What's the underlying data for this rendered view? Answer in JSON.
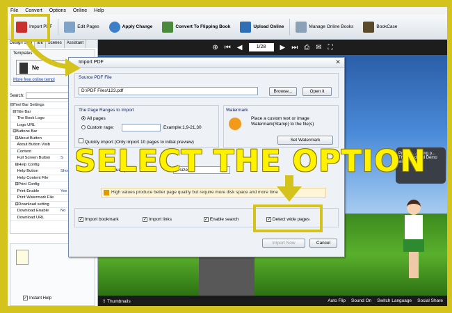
{
  "menubar": {
    "items": [
      "File",
      "Convert",
      "Options",
      "Online",
      "Help"
    ]
  },
  "toolbar": {
    "buttons": [
      {
        "label": "Import PDF",
        "icon": "pdf-icon"
      },
      {
        "label": "Edit Pages",
        "icon": "edit-pages-icon"
      },
      {
        "label": "Apply Change",
        "icon": "apply-change-icon"
      },
      {
        "label": "Convert To Flipping Book",
        "icon": "convert-icon"
      },
      {
        "label": "Upload Online",
        "icon": "upload-icon"
      },
      {
        "label": "Manage Online Books",
        "icon": "manage-books-icon"
      },
      {
        "label": "BookCase",
        "icon": "bookcase-icon"
      }
    ]
  },
  "left": {
    "tabs": [
      "Design Setti",
      "ark",
      "Scenes",
      "Assistant"
    ],
    "templates_title": "Templates",
    "new_label": "Ne",
    "more_templates_link": "More free online templ",
    "search_label": "Search:",
    "tree": [
      {
        "label": "⊟Tool Bar Settings",
        "value": ""
      },
      {
        "label": "  ⊟Title Bar",
        "value": ""
      },
      {
        "label": "      The Book Logo",
        "value": ""
      },
      {
        "label": "      Logo URL",
        "value": ""
      },
      {
        "label": "  ⊟Buttons Bar",
        "value": ""
      },
      {
        "label": "    ⊟About Button",
        "value": ""
      },
      {
        "label": "      About Button Visib",
        "value": ""
      },
      {
        "label": "      Content",
        "value": ""
      },
      {
        "label": "      Full Screen Button",
        "value": "S"
      },
      {
        "label": "    ⊟Help Config",
        "value": ""
      },
      {
        "label": "      Help Button",
        "value": "Show"
      },
      {
        "label": "      Help Content File",
        "value": ""
      },
      {
        "label": "    ⊟Print Config",
        "value": ""
      },
      {
        "label": "      Print Enable",
        "value": "Yes"
      },
      {
        "label": "      Print Watermark File",
        "value": ""
      },
      {
        "label": "    ⊟Download setting",
        "value": ""
      },
      {
        "label": "      Download Enable",
        "value": "No"
      },
      {
        "label": "      Download URL",
        "value": ""
      }
    ],
    "instant_help": "Instant Help"
  },
  "preview": {
    "page_indicator": "1/28",
    "bubble_text": "Profess...rawing p... The wonderful Demo will",
    "thumbnails": "Thumbnails",
    "bottom_right": [
      "Auto Flip",
      "Sound On",
      "Switch Language",
      "Social Share"
    ]
  },
  "dialog": {
    "title": "Import PDF",
    "source_title": "Source PDF File",
    "source_path": "D:\\PDF Files\\123.pdf",
    "browse": "Browse...",
    "open_it": "Open it",
    "ranges_title": "The Page Ranges to Import",
    "all_pages": "All pages",
    "custom_range": "Custom rage:",
    "example": "Example:1,9-21,30",
    "quick_import": "Quickly import (Only import 10 pages to  initial  preview)",
    "watermark_title": "Watermark",
    "watermark_text": "Place a custom text or image Watermark(Stamp) to the file(s)",
    "set_watermark": "Set Watermark",
    "size_select": "e size",
    "quality_label": "uality",
    "warning": "High values produce better page quality but require more disk space and more time",
    "import_bookmark": "Import bookmark",
    "import_links": "Import links",
    "enable_search": "Enable search",
    "detect_wide": "Detect wide pages",
    "import_now": "Import Now",
    "cancel": "Cancel"
  },
  "overlay": {
    "instruction": "SELECT THE OPTION"
  },
  "colors": {
    "highlight": "#d4c31d",
    "overlay_text": "#fff200"
  }
}
